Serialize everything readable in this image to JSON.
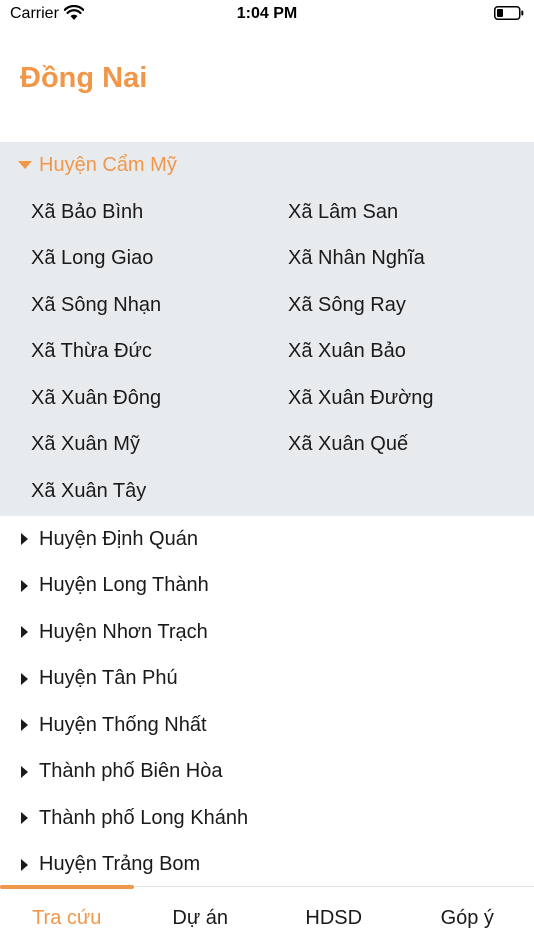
{
  "status_bar": {
    "carrier": "Carrier",
    "time": "1:04 PM"
  },
  "header": {
    "title": "Đồng Nai"
  },
  "tree": {
    "expanded": {
      "label": "Huyện Cẩm Mỹ",
      "wards": [
        "Xã Bảo Bình",
        "Xã Lâm San",
        "Xã Long Giao",
        "Xã Nhân Nghĩa",
        "Xã Sông Nhạn",
        "Xã Sông Ray",
        "Xã Thừa Đức",
        "Xã Xuân Bảo",
        "Xã Xuân Đông",
        "Xã Xuân Đường",
        "Xã Xuân Mỹ",
        "Xã Xuân Quế",
        "Xã Xuân Tây"
      ]
    },
    "collapsed": [
      "Huyện Định Quán",
      "Huyện Long Thành",
      "Huyện Nhơn Trạch",
      "Huyện Tân Phú",
      "Huyện Thống Nhất",
      "Thành phố Biên Hòa",
      "Thành phố Long Khánh",
      "Huyện Trảng Bom"
    ]
  },
  "tabbar": {
    "tabs": [
      {
        "label": "Tra cứu",
        "active": true
      },
      {
        "label": "Dự án",
        "active": false
      },
      {
        "label": "HDSD",
        "active": false
      },
      {
        "label": "Góp ý",
        "active": false
      }
    ]
  },
  "colors": {
    "accent": "#f0974a",
    "expanded_bg": "#e8ebee",
    "text": "#1a1a1a"
  }
}
